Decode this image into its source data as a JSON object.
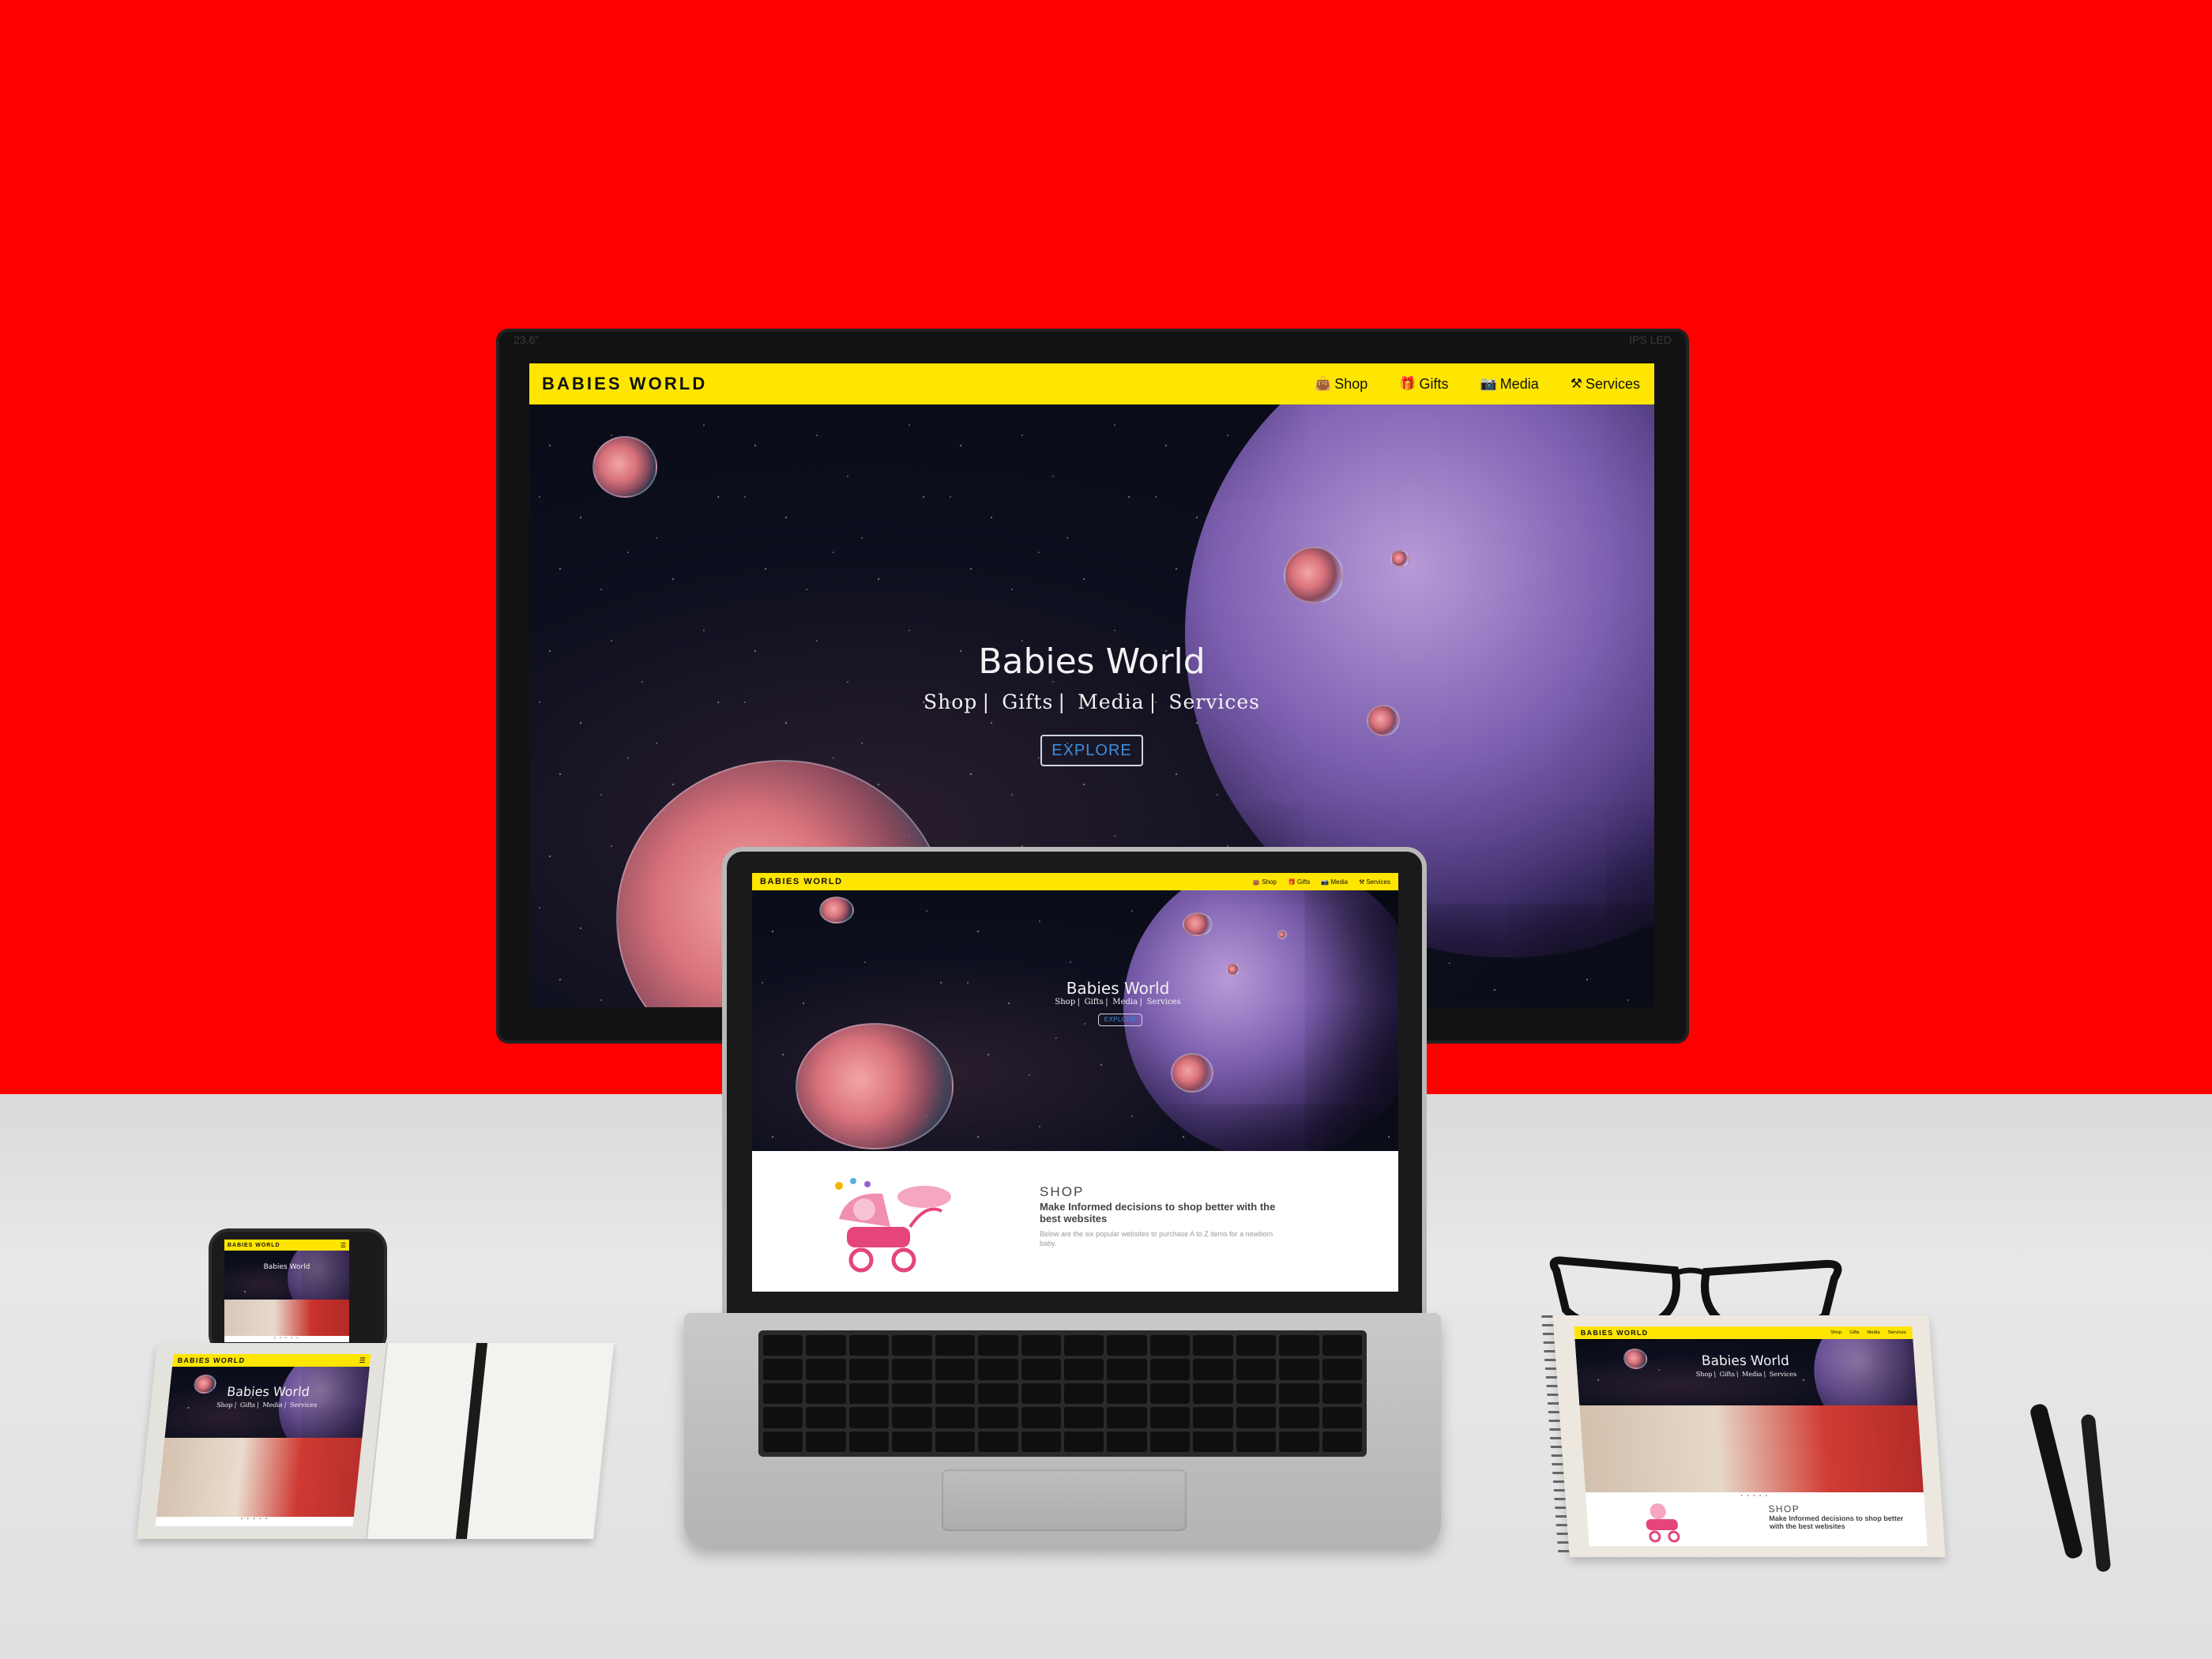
{
  "site": {
    "brand": "BABIES WORLD",
    "nav": [
      {
        "label": "Shop",
        "icon": "shopping-bag-icon",
        "glyph": "👜"
      },
      {
        "label": "Gifts",
        "icon": "gift-icon",
        "glyph": "🎁"
      },
      {
        "label": "Media",
        "icon": "camera-icon",
        "glyph": "📷"
      },
      {
        "label": "Services",
        "icon": "tools-icon",
        "glyph": "⚒"
      }
    ],
    "hero": {
      "title": "Babies World",
      "links": [
        "Shop",
        "Gifts",
        "Media",
        "Services"
      ],
      "cta": "EXPLORE"
    },
    "shop": {
      "heading": "SHOP",
      "subheading": "Make Informed decisions to shop better with the best websites",
      "description": "Below are the six popular websites to purchase A to Z items for a newborn baby."
    },
    "pagination_dots": "• • • • •"
  },
  "monitor": {
    "bezel_left_label": "23.6\"",
    "bezel_right_label": "IPS LED"
  },
  "colors": {
    "backdrop": "#ff0000",
    "navbar": "#ffe600",
    "explore_text": "#3b8fe0"
  }
}
